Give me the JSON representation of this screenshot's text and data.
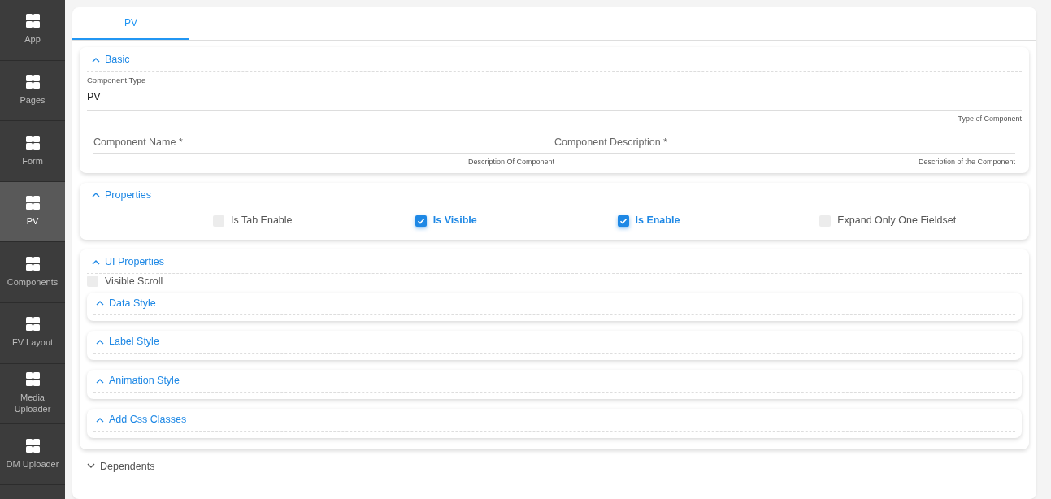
{
  "sidebar": {
    "items": [
      {
        "label": "App",
        "selected": false
      },
      {
        "label": "Pages",
        "selected": false
      },
      {
        "label": "Form",
        "selected": false
      },
      {
        "label": "PV",
        "selected": true
      },
      {
        "label": "Components",
        "selected": false
      },
      {
        "label": "FV Layout",
        "selected": false
      },
      {
        "label": "Media Uploader",
        "selected": false
      },
      {
        "label": "DM Uploader",
        "selected": false
      }
    ]
  },
  "tabs": [
    {
      "label": "PV",
      "selected": true
    }
  ],
  "sections": [
    {
      "kind": "fields",
      "title": "Basic",
      "expanded": true,
      "fields": [
        {
          "label": "Component Type",
          "value": "PV",
          "hint": "Type of Component",
          "kind": "full"
        },
        {
          "placeholder": "Component Name *",
          "hint": "Description Of Component",
          "kind": "half"
        },
        {
          "placeholder": "Component Description *",
          "hint": "Description of the Component",
          "kind": "half"
        }
      ]
    },
    {
      "kind": "checkboxes",
      "title": "Properties",
      "expanded": true,
      "options": [
        {
          "label": "Is Tab Enable",
          "checked": false
        },
        {
          "label": "Is Visible",
          "checked": true
        },
        {
          "label": "Is Enable",
          "checked": true
        },
        {
          "label": "Expand Only One Fieldset",
          "checked": false
        }
      ]
    },
    {
      "kind": "group",
      "title": "UI Properties",
      "expanded": true,
      "option": {
        "label": "Visible Scroll",
        "checked": false
      },
      "subsections": [
        {
          "title": "Data Style",
          "expanded": true
        },
        {
          "title": "Label Style",
          "expanded": true
        },
        {
          "title": "Animation Style",
          "expanded": true
        },
        {
          "title": "Add Css Classes",
          "expanded": true
        }
      ]
    },
    {
      "kind": "empty",
      "title": "Dependents",
      "expanded": false
    }
  ]
}
